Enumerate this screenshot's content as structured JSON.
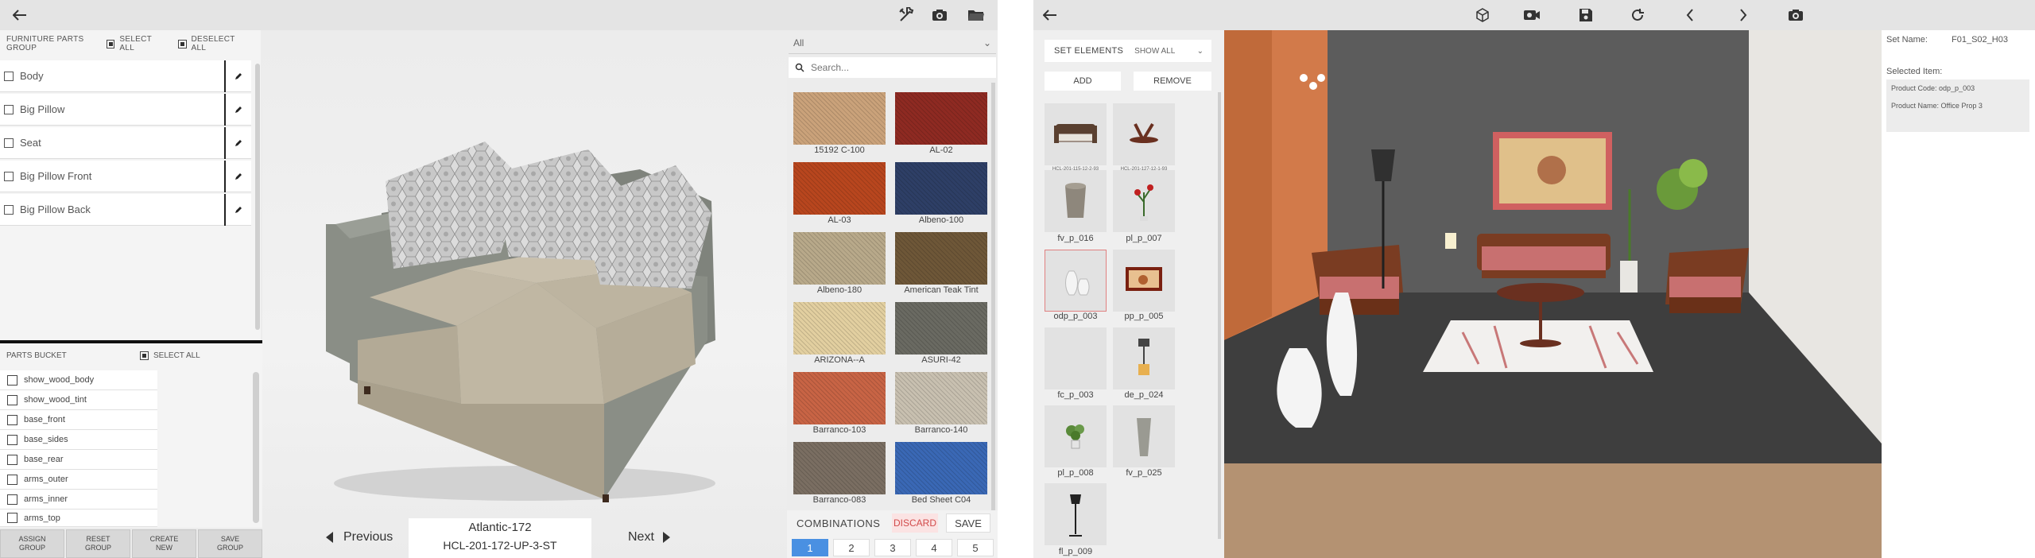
{
  "left_app": {
    "toolbar": {
      "back_icon": "arrow-left-icon",
      "tools_icon": "tools-icon",
      "camera_icon": "camera-icon",
      "folder_icon": "folder-icon"
    },
    "parts_group": {
      "title": "FURNITURE PARTS GROUP",
      "select_all": "SELECT ALL",
      "deselect_all": "DESELECT ALL",
      "items": [
        {
          "label": "Body"
        },
        {
          "label": "Big Pillow"
        },
        {
          "label": "Seat"
        },
        {
          "label": "Big Pillow Front"
        },
        {
          "label": "Big Pillow Back"
        }
      ]
    },
    "parts_bucket": {
      "title": "PARTS BUCKET",
      "select_all": "SELECT ALL",
      "items": [
        {
          "label": "show_wood_body"
        },
        {
          "label": "show_wood_tint"
        },
        {
          "label": "base_front"
        },
        {
          "label": "base_sides"
        },
        {
          "label": "base_rear"
        },
        {
          "label": "arms_outer"
        },
        {
          "label": "arms_inner"
        },
        {
          "label": "arms_top"
        }
      ]
    },
    "group_buttons": [
      {
        "line1": "ASSIGN",
        "line2": "GROUP"
      },
      {
        "line1": "RESET",
        "line2": "GROUP"
      },
      {
        "line1": "CREATE",
        "line2": "NEW"
      },
      {
        "line1": "SAVE",
        "line2": "GROUP"
      }
    ],
    "navigation": {
      "previous": "Previous",
      "next": "Next"
    },
    "product": {
      "name": "Atlantic-172",
      "code": "HCL-201-172-UP-3-ST"
    },
    "fabrics": {
      "filter_value": "All",
      "search_placeholder": "Search...",
      "swatches": [
        {
          "label": "15192 C-100",
          "color": "#caa27a"
        },
        {
          "label": "AL-02",
          "color": "#8e2a22"
        },
        {
          "label": "AL-03",
          "color": "#b8461e"
        },
        {
          "label": "Albeno-100",
          "color": "#2e3f66"
        },
        {
          "label": "Albeno-180",
          "color": "#b8a98a"
        },
        {
          "label": "American Teak Tint",
          "color": "#6e5738"
        },
        {
          "label": "ARIZONA--A",
          "color": "#e2cfa0"
        },
        {
          "label": "ASURI-42",
          "color": "#6a6a62"
        },
        {
          "label": "Barranco-103",
          "color": "#c86445"
        },
        {
          "label": "Barranco-140",
          "color": "#c8c0b0"
        },
        {
          "label": "Barranco-083",
          "color": "#7a6e62"
        },
        {
          "label": "Bed Sheet C04",
          "color": "#3a68b5"
        }
      ]
    },
    "combinations": {
      "title": "COMBINATIONS",
      "discard": "DISCARD",
      "save": "SAVE",
      "numbers": [
        "1",
        "2",
        "3",
        "4",
        "5"
      ],
      "active": "1"
    }
  },
  "right_app": {
    "toolbar": {
      "back_icon": "arrow-left-icon",
      "icons": [
        "cube-icon",
        "video-camera-icon",
        "save-icon",
        "refresh-icon",
        "chevron-left-icon",
        "chevron-right-icon",
        "camera-icon"
      ]
    },
    "set_elements": {
      "tab": "SET ELEMENTS",
      "show_all": "SHOW ALL",
      "add": "ADD",
      "remove": "REMOVE",
      "items": [
        {
          "label": "HCL-201-115-12-2-93"
        },
        {
          "label": "HCL-201-127-12-1-93"
        },
        {
          "label": "fv_p_016"
        },
        {
          "label": "pl_p_007"
        },
        {
          "label": "odp_p_003"
        },
        {
          "label": "pp_p_005"
        },
        {
          "label": "fc_p_003"
        },
        {
          "label": "de_p_024"
        },
        {
          "label": "pl_p_008"
        },
        {
          "label": "fv_p_025"
        },
        {
          "label": "fl_p_009"
        }
      ]
    },
    "info": {
      "set_name_label": "Set Name:",
      "set_name_value": "F01_S02_H03",
      "selected_item_label": "Selected Item:",
      "product_code": "Product Code: odp_p_003",
      "product_name": "Product Name: Office Prop 3"
    }
  }
}
